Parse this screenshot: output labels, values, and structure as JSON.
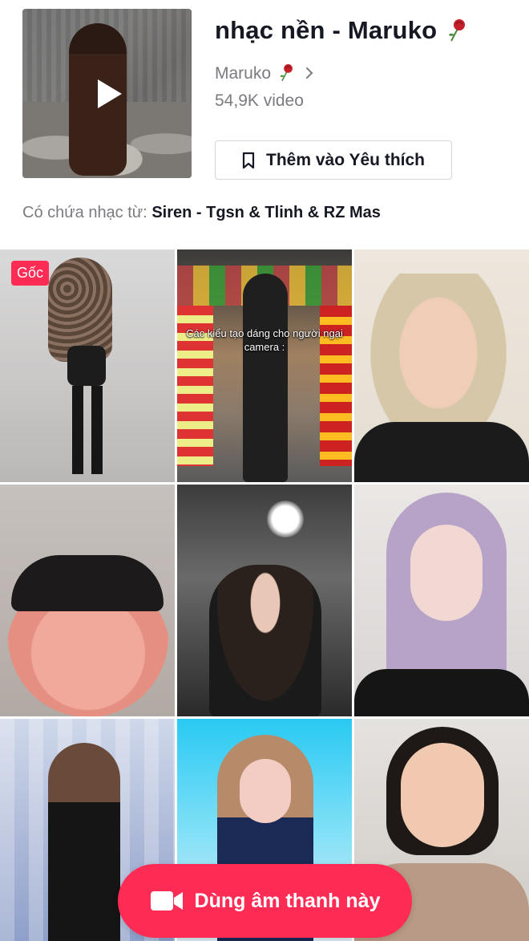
{
  "sound": {
    "title": "nhạc nền - Maruko",
    "author": "Maruko",
    "video_count": "54,9K video",
    "favorite_label": "Thêm vào Yêu thích",
    "contains_prefix": "Có chứa nhạc từ:",
    "contains_track": "Siren - Tgsn & Tlinh & RZ Mas"
  },
  "icons": {
    "play": "play-icon",
    "rose": "rose-icon",
    "chevron": "chevron-right-icon",
    "bookmark": "bookmark-icon",
    "camera": "video-camera-icon"
  },
  "videos": [
    {
      "badge": "Gốc",
      "caption": ""
    },
    {
      "badge": "",
      "caption": "Các kiểu tạo dáng cho người ngại camera :"
    },
    {
      "badge": "",
      "caption": ""
    },
    {
      "badge": "",
      "caption": ""
    },
    {
      "badge": "",
      "caption": ""
    },
    {
      "badge": "",
      "caption": ""
    },
    {
      "badge": "",
      "caption": ""
    },
    {
      "badge": "",
      "caption": ""
    },
    {
      "badge": "",
      "caption": ""
    }
  ],
  "cta": {
    "label": "Dùng âm thanh này"
  },
  "colors": {
    "accent": "#fe2c55",
    "text_primary": "#161823",
    "text_secondary": "#7a7b80"
  }
}
